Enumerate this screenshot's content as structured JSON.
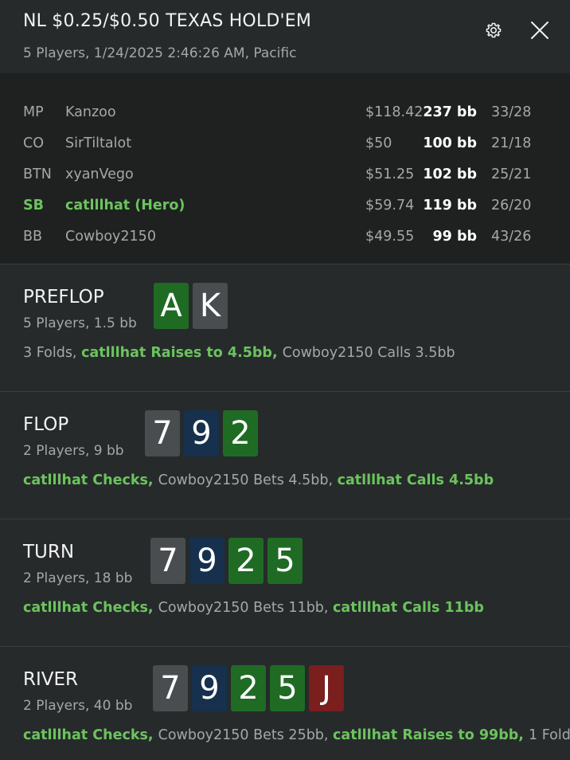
{
  "header": {
    "title": "NL $0.25/$0.50 TEXAS HOLD'EM",
    "subtitle": "5 Players, 1/24/2025 2:46:26 AM, Pacific"
  },
  "players": [
    {
      "pos": "MP",
      "name": "Kanzoo",
      "stack": "$118.42",
      "bb": "237 bb",
      "stats": "33/28",
      "hero": false
    },
    {
      "pos": "CO",
      "name": "SirTiltalot",
      "stack": "$50",
      "bb": "100 bb",
      "stats": "21/18",
      "hero": false
    },
    {
      "pos": "BTN",
      "name": "xyanVego",
      "stack": "$51.25",
      "bb": "102 bb",
      "stats": "25/21",
      "hero": false
    },
    {
      "pos": "SB",
      "name": "catlllhat (Hero)",
      "stack": "$59.74",
      "bb": "119 bb",
      "stats": "26/20",
      "hero": true
    },
    {
      "pos": "BB",
      "name": "Cowboy2150",
      "stack": "$49.55",
      "bb": "99 bb",
      "stats": "43/26",
      "hero": false
    }
  ],
  "colors": {
    "hero_green": "#6cc35e",
    "card_green": "#1f6b24",
    "card_grey": "#4a4d4f",
    "card_blue": "#16304d",
    "card_red": "#7a1e1e"
  },
  "streets": [
    {
      "name": "PREFLOP",
      "info": "5 Players, 1.5 bb",
      "cards": [
        {
          "rank": "A",
          "color": "green"
        },
        {
          "rank": "K",
          "color": "grey"
        }
      ],
      "actions": [
        {
          "text": "3 Folds, ",
          "hero": false
        },
        {
          "text": "catlllhat Raises to 4.5bb, ",
          "hero": true
        },
        {
          "text": "Cowboy2150 Calls 3.5bb",
          "hero": false
        }
      ]
    },
    {
      "name": "FLOP",
      "info": "2 Players, 9 bb",
      "cards": [
        {
          "rank": "7",
          "color": "grey"
        },
        {
          "rank": "9",
          "color": "blue"
        },
        {
          "rank": "2",
          "color": "green"
        }
      ],
      "actions": [
        {
          "text": "catlllhat Checks, ",
          "hero": true
        },
        {
          "text": "Cowboy2150 Bets 4.5bb, ",
          "hero": false
        },
        {
          "text": "catlllhat Calls 4.5bb",
          "hero": true
        }
      ]
    },
    {
      "name": "TURN",
      "info": "2 Players, 18 bb",
      "cards": [
        {
          "rank": "7",
          "color": "grey"
        },
        {
          "rank": "9",
          "color": "blue"
        },
        {
          "rank": "2",
          "color": "green"
        },
        {
          "rank": "5",
          "color": "green"
        }
      ],
      "actions": [
        {
          "text": "catlllhat Checks, ",
          "hero": true
        },
        {
          "text": "Cowboy2150 Bets 11bb, ",
          "hero": false
        },
        {
          "text": "catlllhat Calls 11bb",
          "hero": true
        }
      ]
    },
    {
      "name": "RIVER",
      "info": "2 Players, 40 bb",
      "cards": [
        {
          "rank": "7",
          "color": "grey"
        },
        {
          "rank": "9",
          "color": "blue"
        },
        {
          "rank": "2",
          "color": "green"
        },
        {
          "rank": "5",
          "color": "green"
        },
        {
          "rank": "J",
          "color": "red"
        }
      ],
      "actions": [
        {
          "text": "catlllhat Checks, ",
          "hero": true
        },
        {
          "text": "Cowboy2150 Bets 25bb, ",
          "hero": false
        },
        {
          "text": "catlllhat Raises to 99bb, ",
          "hero": true
        },
        {
          "text": "1 Fold",
          "hero": false
        }
      ]
    }
  ]
}
